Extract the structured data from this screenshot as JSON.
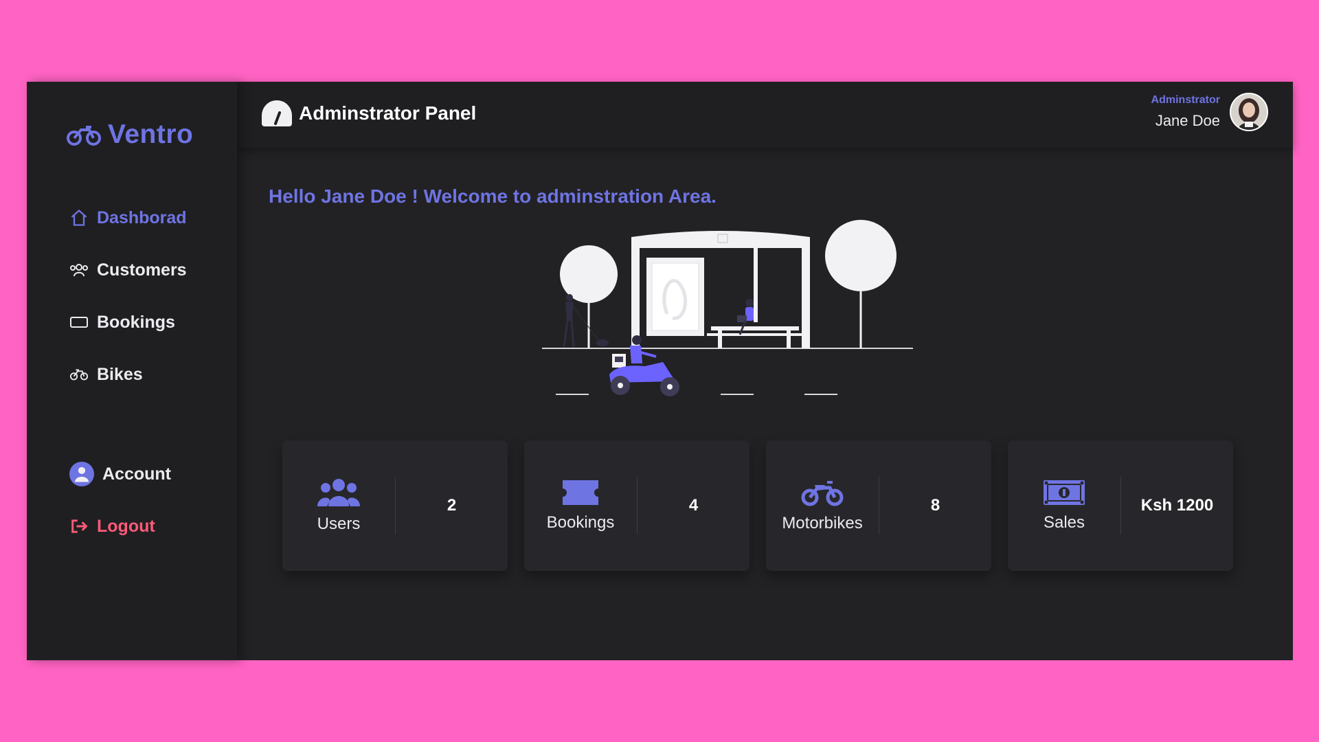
{
  "brand": {
    "name": "Ventro",
    "icon": "motorbike-icon"
  },
  "sidebar": {
    "items": [
      {
        "label": "Dashborad",
        "icon": "home-icon",
        "active": true
      },
      {
        "label": "Customers",
        "icon": "users-icon"
      },
      {
        "label": "Bookings",
        "icon": "ticket-icon"
      },
      {
        "label": "Bikes",
        "icon": "bicycle-icon"
      }
    ],
    "account_label": "Account",
    "logout_label": "Logout"
  },
  "header": {
    "title": "Adminstrator Panel",
    "role": "Adminstrator",
    "user_name": "Jane Doe"
  },
  "welcome": "Hello Jane Doe ! Welcome to adminstration Area.",
  "cards": [
    {
      "label": "Users",
      "value": "2",
      "icon": "users-icon"
    },
    {
      "label": "Bookings",
      "value": "4",
      "icon": "ticket-icon"
    },
    {
      "label": "Motorbikes",
      "value": "8",
      "icon": "motorbike-icon"
    },
    {
      "label": "Sales",
      "value": "Ksh 1200",
      "icon": "money-icon"
    }
  ],
  "colors": {
    "accent": "#6f74e3",
    "background": "#ff63c3",
    "panel": "#222225",
    "sidebar": "#1f1f22",
    "logout": "#ff5a78"
  }
}
